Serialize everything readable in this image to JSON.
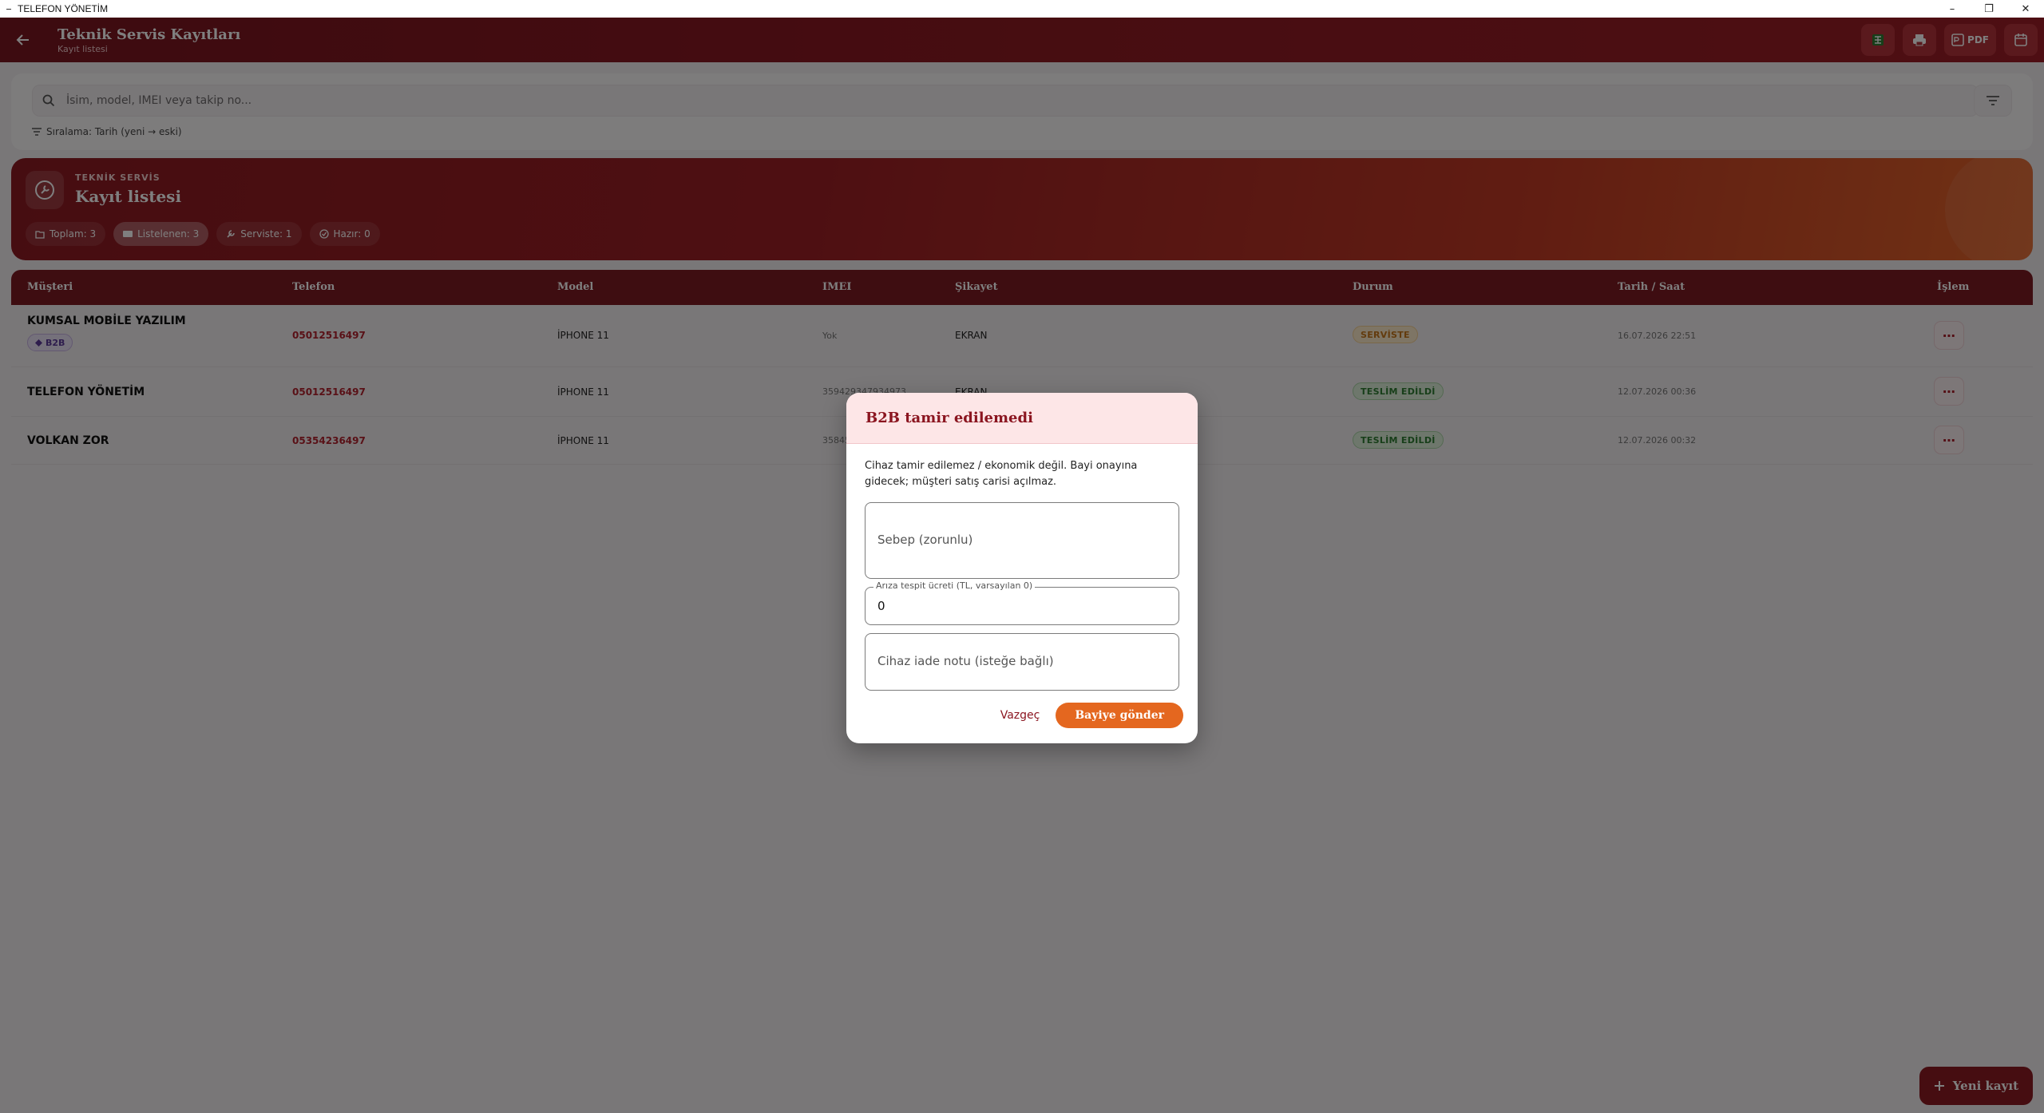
{
  "window": {
    "title": "TELEFON YÖNETİM",
    "controls": {
      "minimize": "–",
      "maximize": "❐",
      "close": "✕"
    }
  },
  "header": {
    "title": "Teknik Servis Kayıtları",
    "subtitle": "Kayıt listesi",
    "actions": [
      {
        "name": "excel-icon"
      },
      {
        "name": "print-icon"
      },
      {
        "name": "pdf-icon",
        "label": "PDF"
      },
      {
        "name": "calendar-icon"
      }
    ]
  },
  "search": {
    "placeholder": "İsim, model, IMEI veya takip no...",
    "sort_label": "Sıralama: Tarih (yeni → eski)"
  },
  "banner": {
    "kicker": "TEKNİK SERVİS",
    "title": "Kayıt listesi",
    "chips": [
      {
        "label": "Toplam: 3",
        "icon": "folder-icon",
        "active": false
      },
      {
        "label": "Listelenen: 3",
        "icon": "list-icon",
        "active": true
      },
      {
        "label": "Serviste: 1",
        "icon": "build-icon",
        "active": false
      },
      {
        "label": "Hazır: 0",
        "icon": "check-circle-icon",
        "active": false
      }
    ]
  },
  "table": {
    "columns": [
      "Müşteri",
      "Telefon",
      "Model",
      "IMEI",
      "Şikayet",
      "Durum",
      "Tarih / Saat",
      "İşlem"
    ],
    "rows": [
      {
        "customer": "KUMSAL MOBİLE YAZILIM",
        "badge": "B2B",
        "phone": "05012516497",
        "model": "İPHONE 11",
        "imei": "Yok",
        "complaint": "EKRAN",
        "status": "SERVİSTE",
        "status_kind": "service",
        "date": "16.07.2026 22:51"
      },
      {
        "customer": "TELEFON YÖNETİM",
        "badge": "",
        "phone": "05012516497",
        "model": "İPHONE 11",
        "imei": "359429347934973",
        "complaint": "EKRAN",
        "status": "TESLİM EDİLDİ",
        "status_kind": "done",
        "date": "12.07.2026 00:36"
      },
      {
        "customer": "VOLKAN ZOR",
        "badge": "",
        "phone": "05354236497",
        "model": "İPHONE 11",
        "imei": "35845",
        "complaint": "",
        "status": "TESLİM EDİLDİ",
        "status_kind": "done",
        "date": "12.07.2026 00:32"
      }
    ]
  },
  "fab": {
    "label": "Yeni kayıt",
    "icon": "plus-icon"
  },
  "dialog": {
    "title": "B2B tamir edilemedi",
    "description": "Cihaz tamir edilemez / ekonomik değil. Bayi onayına gidecek; müşteri satış carisi açılmaz.",
    "reason_placeholder": "Sebep (zorunlu)",
    "fee_label": "Arıza tespit ücreti (TL, varsayılan 0)",
    "fee_value": "0",
    "note_placeholder": "Cihaz iade notu (isteğe bağlı)",
    "cancel_label": "Vazgeç",
    "submit_label": "Bayiye gönder"
  },
  "colors": {
    "primary": "#8c1a22",
    "accent": "#e4671f",
    "service": "#c7761a",
    "done": "#2e7d32",
    "b2b": "#5d3a9b"
  }
}
